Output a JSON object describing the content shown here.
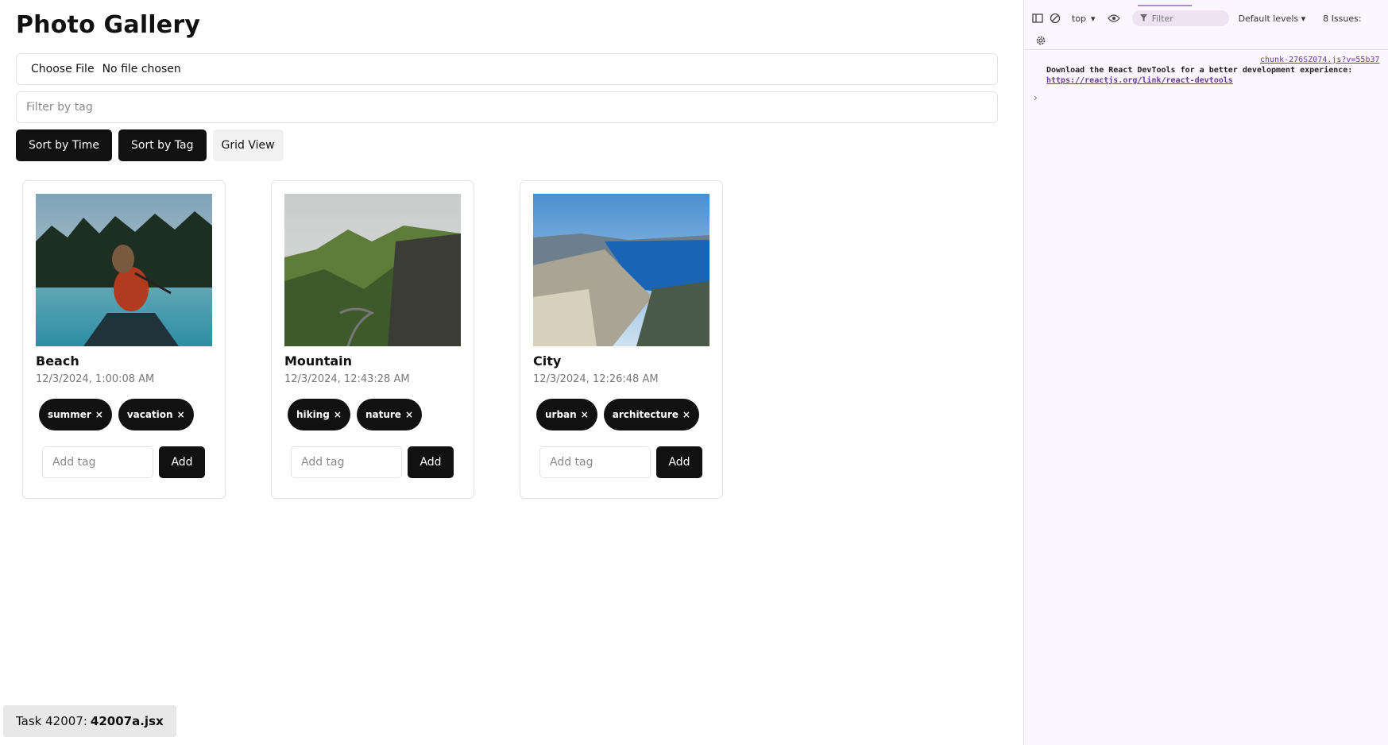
{
  "page": {
    "title": "Photo Gallery",
    "file_button": "Choose File",
    "file_status": "No file chosen",
    "filter_placeholder": "Filter by tag",
    "buttons": {
      "sort_time": "Sort by Time",
      "sort_tag": "Sort by Tag",
      "grid_view": "Grid View"
    }
  },
  "photos": [
    {
      "name": "Beach",
      "date": "12/3/2024, 1:00:08 AM",
      "tags": [
        "summer",
        "vacation"
      ],
      "add_placeholder": "Add tag",
      "add_label": "Add",
      "image": "woman-in-canoe-on-lake"
    },
    {
      "name": "Mountain",
      "date": "12/3/2024, 12:43:28 AM",
      "tags": [
        "hiking",
        "nature"
      ],
      "add_placeholder": "Add tag",
      "add_label": "Add",
      "image": "green-mountain-ridge-road"
    },
    {
      "name": "City",
      "date": "12/3/2024, 12:26:48 AM",
      "tags": [
        "urban",
        "architecture"
      ],
      "add_placeholder": "Add tag",
      "add_label": "Add",
      "image": "fjord-cliff-view"
    }
  ],
  "tag_remove_symbol": "×",
  "task": {
    "prefix": "Task 42007:",
    "file": "42007a.jsx"
  },
  "devtools": {
    "context": "top",
    "filter_placeholder": "Filter",
    "levels": "Default levels",
    "issues": "8 Issues:",
    "source": "chunk-276SZ074.js?v=55b37",
    "message": "Download the React DevTools for a better development experience:",
    "link": "https://reactjs.org/link/react-devtools",
    "prompt": "›"
  },
  "colors": {
    "button_dark": "#111111",
    "devtools_bg": "#fcf6fe",
    "devtools_link": "#6b3b9a"
  }
}
